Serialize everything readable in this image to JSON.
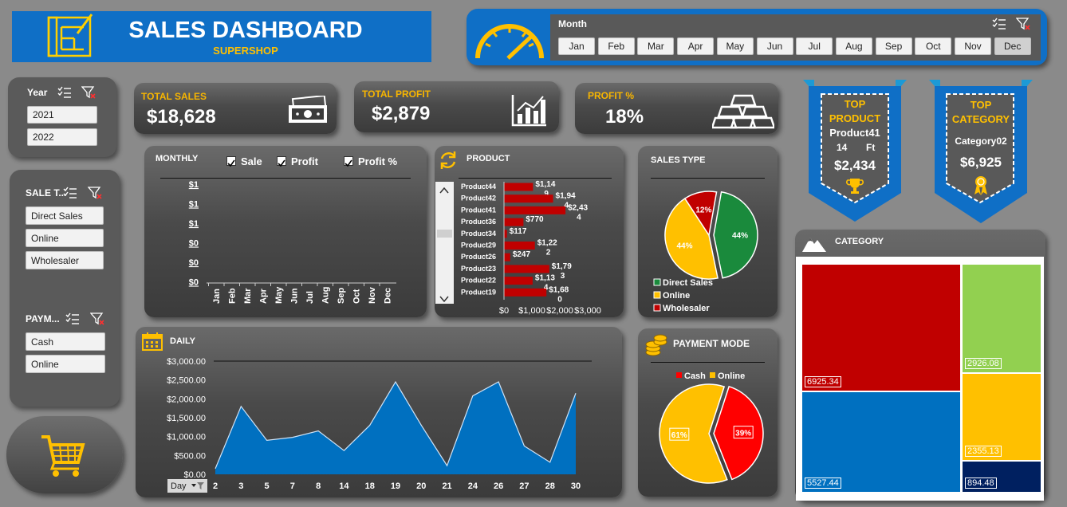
{
  "header": {
    "title": "SALES DASHBOARD",
    "subtitle": "SUPERSHOP"
  },
  "month_slicer": {
    "label": "Month",
    "months": [
      "Jan",
      "Feb",
      "Mar",
      "Apr",
      "May",
      "Jun",
      "Jul",
      "Aug",
      "Sep",
      "Oct",
      "Nov",
      "Dec"
    ],
    "selected": "Dec"
  },
  "year_slicer": {
    "label": "Year",
    "items": [
      "2021",
      "2022"
    ]
  },
  "sale_type_slicer": {
    "label": "SALE T...",
    "items": [
      "Direct Sales",
      "Online",
      "Wholesaler"
    ]
  },
  "payment_slicer": {
    "label": "PAYM...",
    "items": [
      "Cash",
      "Online"
    ]
  },
  "kpis": {
    "total_sales_label": "TOTAL SALES",
    "total_sales_value": "$18,628",
    "total_profit_label": "TOTAL PROFIT",
    "total_profit_value": "$2,879",
    "profit_pct_label": "PROFIT %",
    "profit_pct_value": "18%"
  },
  "top_product": {
    "title_1": "TOP",
    "title_2": "PRODUCT",
    "name": "Product41",
    "line_1": "14",
    "line_2": "Ft",
    "value": "$2,434"
  },
  "top_category": {
    "title_1": "TOP",
    "title_2": "CATEGORY",
    "name": "Category02",
    "value": "$6,925"
  },
  "monthly": {
    "title": "MONTHLY",
    "checkboxes": [
      {
        "label": "Sale",
        "checked": true
      },
      {
        "label": "Profit",
        "checked": true
      },
      {
        "label": "Profit %",
        "checked": true
      }
    ],
    "y_ticks": [
      "$1",
      "$1",
      "$1",
      "$0",
      "$0",
      "$0"
    ],
    "months": [
      "Jan",
      "Feb",
      "Mar",
      "Apr",
      "May",
      "Jun",
      "Jul",
      "Aug",
      "Sep",
      "Oct",
      "Nov",
      "Dec"
    ]
  },
  "product": {
    "title": "PRODUCT",
    "x_ticks": [
      "$0",
      "$1,000",
      "$2,000",
      "$3,000"
    ],
    "bars": [
      {
        "name": "Product44",
        "value": 1149,
        "label_a": "$1,14",
        "label_b": "9"
      },
      {
        "name": "Product42",
        "value": 1944,
        "label_a": "$1,94",
        "label_b": "4"
      },
      {
        "name": "Product41",
        "value": 2434,
        "label_a": "$2,43",
        "label_b": "4"
      },
      {
        "name": "Product36",
        "value": 770,
        "label_a": "$770",
        "label_b": ""
      },
      {
        "name": "Product34",
        "value": 117,
        "label_a": "$117",
        "label_b": ""
      },
      {
        "name": "Product29",
        "value": 1222,
        "label_a": "$1,22",
        "label_b": "2"
      },
      {
        "name": "Product26",
        "value": 247,
        "label_a": "$247",
        "label_b": ""
      },
      {
        "name": "Product23",
        "value": 1793,
        "label_a": "$1,79",
        "label_b": "3"
      },
      {
        "name": "Product22",
        "value": 1134,
        "label_a": "$1,13",
        "label_b": "4"
      },
      {
        "name": "Product19",
        "value": 1680,
        "label_a": "$1,68",
        "label_b": "0"
      }
    ]
  },
  "sales_type": {
    "title": "SALES TYPE",
    "slices": [
      {
        "name": "Direct Sales",
        "pct": 44,
        "label": "44%",
        "color": "#1a8a3c"
      },
      {
        "name": "Online",
        "pct": 44,
        "label": "44%",
        "color": "#ffc000"
      },
      {
        "name": "Wholesaler",
        "pct": 12,
        "label": "12%",
        "color": "#c00000"
      }
    ]
  },
  "daily": {
    "title": "DAILY",
    "y_ticks": [
      "$3,000.00",
      "$2,500.00",
      "$2,000.00",
      "$1,500.00",
      "$1,000.00",
      "$500.00",
      "$0.00"
    ],
    "filter_label": "Day",
    "points": [
      {
        "day": "2",
        "value": 150
      },
      {
        "day": "3",
        "value": 1800
      },
      {
        "day": "5",
        "value": 900
      },
      {
        "day": "7",
        "value": 980
      },
      {
        "day": "8",
        "value": 1150
      },
      {
        "day": "14",
        "value": 630
      },
      {
        "day": "18",
        "value": 1300
      },
      {
        "day": "19",
        "value": 2450
      },
      {
        "day": "20",
        "value": 1300
      },
      {
        "day": "21",
        "value": 230
      },
      {
        "day": "24",
        "value": 2080
      },
      {
        "day": "26",
        "value": 2450
      },
      {
        "day": "27",
        "value": 750
      },
      {
        "day": "28",
        "value": 320
      },
      {
        "day": "30",
        "value": 2150
      }
    ]
  },
  "payment_mode": {
    "title": "PAYMENT MODE",
    "slices": [
      {
        "name": "Cash",
        "pct": 39,
        "label": "39%",
        "color": "#ff0000"
      },
      {
        "name": "Online",
        "pct": 61,
        "label": "61%",
        "color": "#ffc000"
      }
    ]
  },
  "category": {
    "title": "CATEGORY",
    "tiles": [
      {
        "value": "6925.34",
        "color": "#c00000"
      },
      {
        "value": "5527.44",
        "color": "#0070c0"
      },
      {
        "value": "2926.08",
        "color": "#92d050"
      },
      {
        "value": "2355.13",
        "color": "#ffc000"
      },
      {
        "value": "894.48",
        "color": "#002060"
      }
    ]
  },
  "colors": {
    "accent_blue": "#0f6fc6",
    "gold": "#f7b500",
    "bar_red": "#c00000",
    "area_blue": "#0070c0"
  },
  "chart_data": [
    {
      "type": "bar",
      "title": "PRODUCT",
      "categories": [
        "Product44",
        "Product42",
        "Product41",
        "Product36",
        "Product34",
        "Product29",
        "Product26",
        "Product23",
        "Product22",
        "Product19"
      ],
      "values": [
        1149,
        1944,
        2434,
        770,
        117,
        1222,
        247,
        1793,
        1134,
        1680
      ],
      "xlim": [
        0,
        3000
      ]
    },
    {
      "type": "pie",
      "title": "SALES TYPE",
      "categories": [
        "Direct Sales",
        "Online",
        "Wholesaler"
      ],
      "values": [
        44,
        44,
        12
      ]
    },
    {
      "type": "area",
      "title": "DAILY",
      "x": [
        "2",
        "3",
        "5",
        "7",
        "8",
        "14",
        "18",
        "19",
        "20",
        "21",
        "24",
        "26",
        "27",
        "28",
        "30"
      ],
      "values": [
        150,
        1800,
        900,
        980,
        1150,
        630,
        1300,
        2450,
        1300,
        230,
        2080,
        2450,
        750,
        320,
        2150
      ],
      "ylim": [
        0,
        3000
      ]
    },
    {
      "type": "pie",
      "title": "PAYMENT MODE",
      "categories": [
        "Cash",
        "Online"
      ],
      "values": [
        39,
        61
      ]
    },
    {
      "type": "heatmap",
      "title": "CATEGORY",
      "values": [
        6925.34,
        5527.44,
        2926.08,
        2355.13,
        894.48
      ]
    }
  ]
}
